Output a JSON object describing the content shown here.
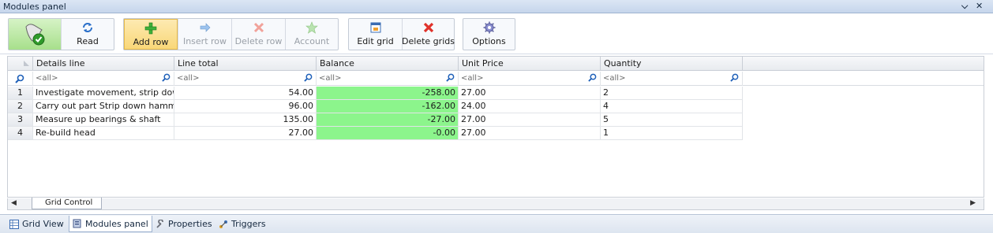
{
  "window": {
    "title": "Modules panel",
    "pin_glyph": "⌵",
    "close_glyph": "✕"
  },
  "toolbar": {
    "buttons": [
      {
        "label": "",
        "icon": "validate-scroll-icon"
      },
      {
        "label": "Read",
        "icon": "refresh-icon"
      },
      {
        "label": "Add row",
        "icon": "plus-icon"
      },
      {
        "label": "Insert row",
        "icon": "arrow-right-icon"
      },
      {
        "label": "Delete row",
        "icon": "red-x-icon"
      },
      {
        "label": "Account",
        "icon": "star-icon"
      },
      {
        "label": "Edit grid",
        "icon": "window-icon"
      },
      {
        "label": "Delete grids",
        "icon": "red-x-icon"
      },
      {
        "label": "Options",
        "icon": "gear-icon"
      }
    ]
  },
  "grid": {
    "columns": [
      "Details line",
      "Line total",
      "Balance",
      "Unit Price",
      "Quantity"
    ],
    "filter_placeholder": "<all>",
    "rows": [
      {
        "n": "1",
        "details": "Investigate movement, strip down ...",
        "line_total": "54.00",
        "balance": "-258.00",
        "unit_price": "27.00",
        "quantity": "2"
      },
      {
        "n": "2",
        "details": "Carry out part Strip down hammer ...",
        "line_total": "96.00",
        "balance": "-162.00",
        "unit_price": "24.00",
        "quantity": "4"
      },
      {
        "n": "3",
        "details": "Measure up bearings & shaft",
        "line_total": "135.00",
        "balance": "-27.00",
        "unit_price": "27.00",
        "quantity": "5"
      },
      {
        "n": "4",
        "details": "Re-build head",
        "line_total": "27.00",
        "balance": "-0.00",
        "unit_price": "27.00",
        "quantity": "1"
      }
    ],
    "tab_label": "Grid Control",
    "highlight_color": "#8cf58c"
  },
  "bottom_tabs": [
    {
      "label": "Grid View",
      "icon": "grid-view-icon"
    },
    {
      "label": "Modules panel",
      "icon": "modules-icon"
    },
    {
      "label": "Properties",
      "icon": "wrench-icon"
    },
    {
      "label": "Triggers",
      "icon": "trigger-icon"
    }
  ]
}
